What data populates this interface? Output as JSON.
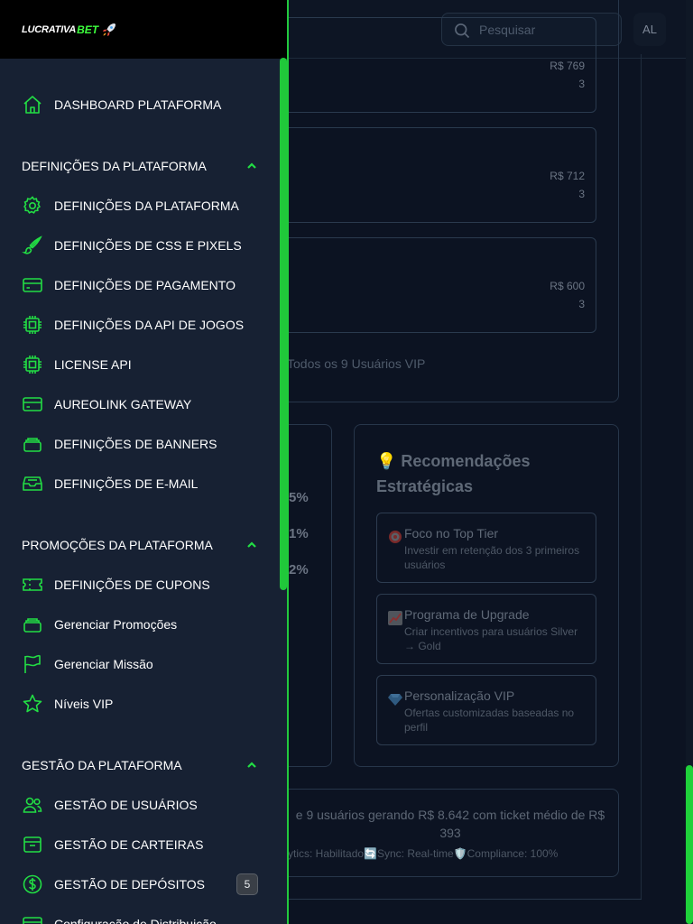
{
  "header": {
    "search_placeholder": "Pesquisar",
    "avatar_initials": "AL"
  },
  "brand": {
    "name_part1": "LUCRATIVA",
    "name_part2": "BET"
  },
  "background": {
    "vip_cards": [
      {
        "amount": "R$ 769",
        "count": "3"
      },
      {
        "amount": "R$ 712",
        "count": "3"
      },
      {
        "amount": "R$ 600",
        "count": "3"
      }
    ],
    "all_vip_link": "Todos os 9 Usuários VIP",
    "percent_fragments": [
      "5%",
      "1%",
      "2%"
    ],
    "recommendations": {
      "title": "💡 Recomendações Estratégicas",
      "items": [
        {
          "title": "Foco no Top Tier",
          "desc": "Investir em retenção dos 3 primeiros usuários"
        },
        {
          "title": "Programa de Upgrade",
          "desc": "Criar incentivos para usuários Silver → Gold"
        },
        {
          "title": "Personalização VIP",
          "desc": "Ofertas customizadas baseadas no perfil"
        }
      ]
    },
    "summary": {
      "text": "e 9 usuários gerando R$ 8.642 com ticket médio de R$ 393",
      "footer": "ytics: Habilitado🔄Sync: Real-time🛡️Compliance: 100%"
    }
  },
  "sidebar": {
    "dashboard": "DASHBOARD PLATAFORMA",
    "sections": [
      {
        "title": "DEFINIÇÕES DA PLATAFORMA",
        "items": [
          "DEFINIÇÕES DA PLATAFORMA",
          "DEFINIÇÕES DE CSS E PIXELS",
          "DEFINIÇÕES DE PAGAMENTO",
          "DEFINIÇÕES DA API DE JOGOS",
          "LICENSE API",
          "AUREOLINK GATEWAY",
          "DEFINIÇÕES DE BANNERS",
          "DEFINIÇÕES DE E-MAIL"
        ]
      },
      {
        "title": "PROMOÇÕES DA PLATAFORMA",
        "items": [
          "DEFINIÇÕES DE CUPONS",
          "Gerenciar Promoções",
          "Gerenciar Missão",
          "Níveis VIP"
        ]
      },
      {
        "title": "GESTÃO DA PLATAFORMA",
        "items": [
          "GESTÃO DE USUÁRIOS",
          "GESTÃO DE CARTEIRAS",
          "GESTÃO DE DEPÓSITOS",
          "Configuração de Distribuição"
        ]
      }
    ],
    "deposits_badge": "5"
  },
  "colors": {
    "accent": "#22c93d",
    "sidebar_bg": "#172133",
    "page_bg": "#0c1322"
  },
  "icons": {
    "dashboard": "home-icon",
    "settings": "gear-icon",
    "css": "brush-icon",
    "payment": "credit-card-icon",
    "api": "chip-icon",
    "gateway": "credit-card-icon",
    "banners": "layers-icon",
    "email": "inbox-icon",
    "coupons": "ticket-icon",
    "promotions": "layers-icon",
    "mission": "flag-icon",
    "vip": "star-icon",
    "users": "users-icon",
    "wallets": "wallet-icon",
    "deposits": "dollar-icon",
    "distribution": "card-icon"
  }
}
